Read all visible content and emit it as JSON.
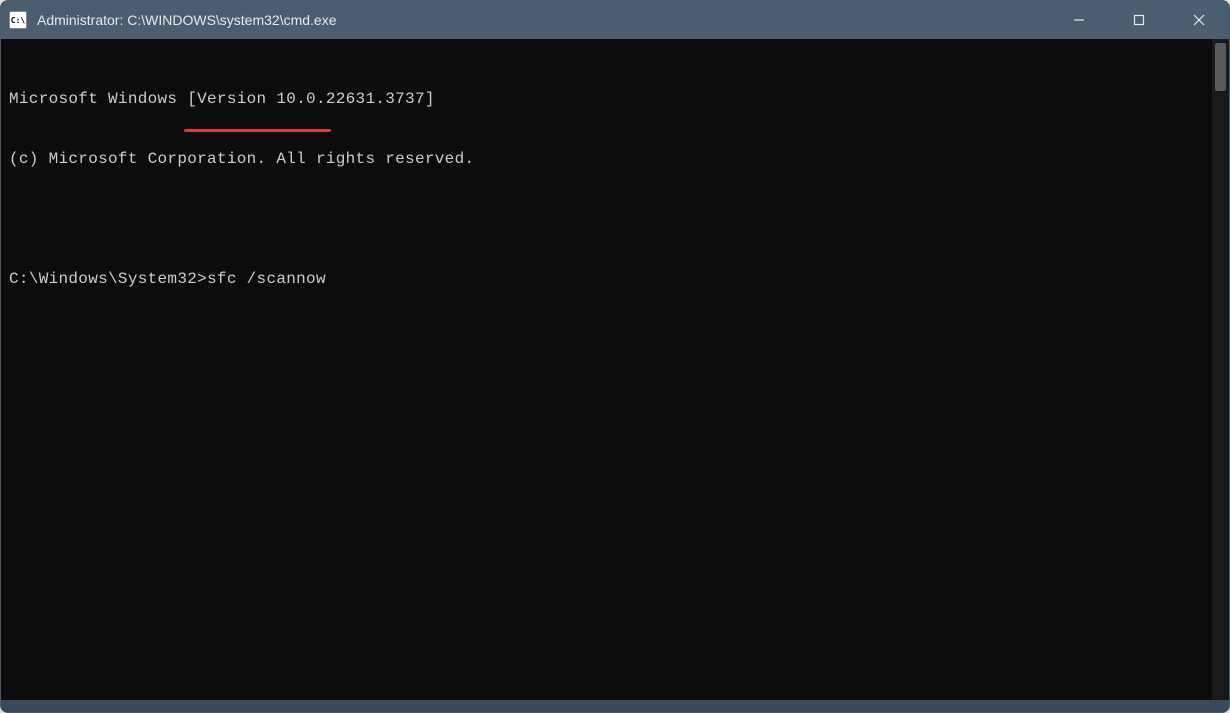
{
  "window": {
    "title": "Administrator: C:\\WINDOWS\\system32\\cmd.exe",
    "icon_label": "C:\\"
  },
  "terminal": {
    "line1": "Microsoft Windows [Version 10.0.22631.3737]",
    "line2": "(c) Microsoft Corporation. All rights reserved.",
    "prompt": "C:\\Windows\\System32>",
    "command": "sfc /scannow"
  }
}
